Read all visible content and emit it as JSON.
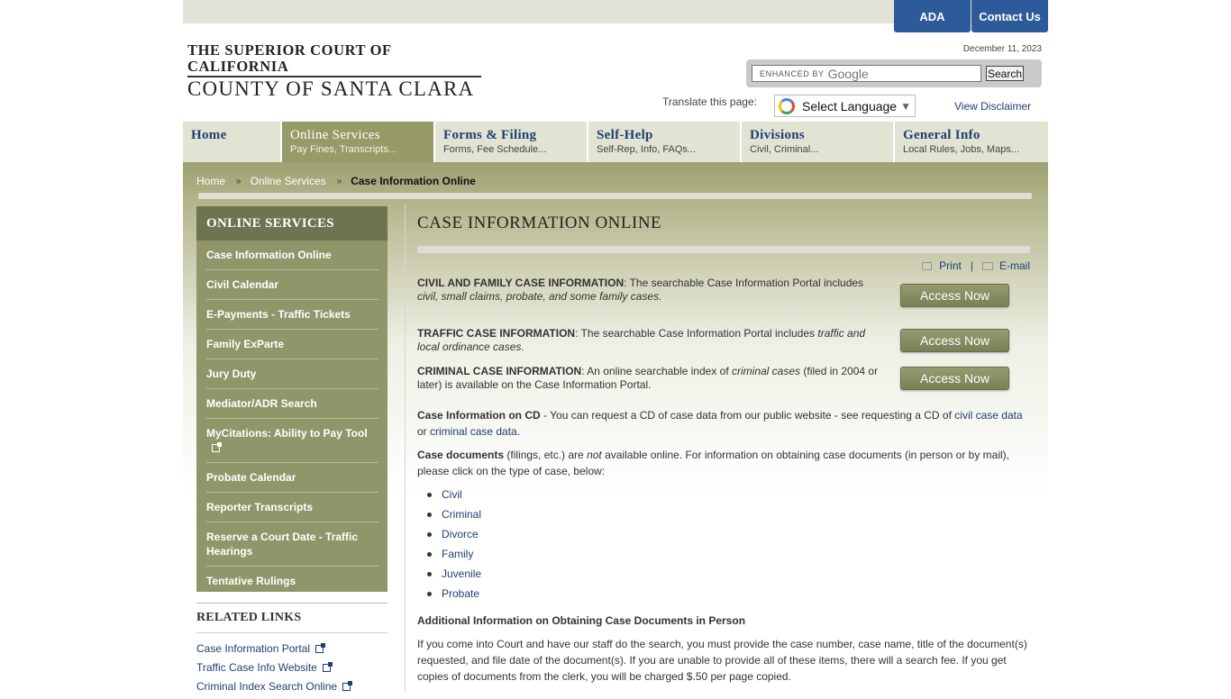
{
  "header": {
    "ada_label": "ADA",
    "contact_label": "Contact Us",
    "logo_line1": "THE SUPERIOR COURT OF CALIFORNIA",
    "logo_line2": "COUNTY OF SANTA CLARA",
    "date": "December 11, 2023",
    "search": {
      "enhanced_by": "ENHANCED BY",
      "google": "Google",
      "button_label": "Search"
    },
    "translate_label": "Translate this page:",
    "translate_select": "Select Language",
    "disclaimer_label": "View Disclaimer"
  },
  "nav": [
    {
      "title": "Home",
      "sub": ""
    },
    {
      "title": "Online Services",
      "sub": "Pay Fines, Transcripts..."
    },
    {
      "title": "Forms & Filing",
      "sub": "Forms, Fee Schedule..."
    },
    {
      "title": "Self-Help",
      "sub": "Self-Rep, Info, FAQs..."
    },
    {
      "title": "Divisions",
      "sub": "Civil, Criminal..."
    },
    {
      "title": "General Info",
      "sub": "Local Rules, Jobs, Maps..."
    }
  ],
  "breadcrumb": {
    "home": "Home",
    "sep": "»",
    "section": "Online Services",
    "current": "Case Information Online"
  },
  "sidebar": {
    "heading": "ONLINE SERVICES",
    "items": [
      "Case Information Online",
      "Civil Calendar",
      "E-Payments - Traffic Tickets",
      "Family ExParte",
      "Jury Duty",
      "Mediator/ADR Search",
      "MyCitations: Ability to Pay Tool",
      "Probate Calendar",
      "Reporter Transcripts",
      "Reserve a Court Date - Traffic Hearings",
      "Tentative Rulings"
    ]
  },
  "related": {
    "heading": "RELATED LINKS",
    "links": [
      "Case Information Portal",
      "Traffic Case Info Website",
      "Criminal Index Search Online"
    ]
  },
  "main": {
    "title": "CASE INFORMATION ONLINE",
    "print_label": "Print",
    "tools_sep": "|",
    "email_label": "E-mail",
    "access_label": "Access Now",
    "civil": {
      "bold": "CIVIL AND FAMILY CASE INFORMATION",
      "text": ": The searchable Case Information Portal includes ",
      "italic": "civil, small claims, probate, and some family cases."
    },
    "traffic": {
      "bold": "TRAFFIC CASE INFORMATION",
      "text": ": The searchable Case Information Portal includes ",
      "italic": "traffic and local ordinance cases."
    },
    "criminal": {
      "bold": "CRIMINAL CASE INFORMATION",
      "text": ": An online searchable index of ",
      "italic": "criminal cases",
      "text2": " (filed in 2004 or later) is available on the Case Information Portal."
    },
    "cd": {
      "bold": "Case Information on CD",
      "text": " - You can request a CD of case data from our public website - see requesting a CD of ",
      "link1": "civil case data",
      "or": " or ",
      "link2": "criminal case data",
      "end": "."
    },
    "docs": {
      "bold": "Case documents",
      "text": " (filings, etc.) are ",
      "italic": "not",
      "text2": " available online. For information on obtaining case documents (in person or by mail), please click on the type of case, below:"
    },
    "doc_types": [
      "Civil",
      "Criminal",
      "Divorce",
      "Family",
      "Juvenile",
      "Probate"
    ],
    "addl_heading": "Additional Information on Obtaining Case Documents in Person",
    "addl_text": "If you come into Court and have our staff do the search, you must provide the case number, case name, title of the document(s) requested, and file date of the document(s). If you are unable to provide all of these items, there will a search fee. If you get copies of documents from the clerk, you will be charged $.50 per page copied."
  }
}
